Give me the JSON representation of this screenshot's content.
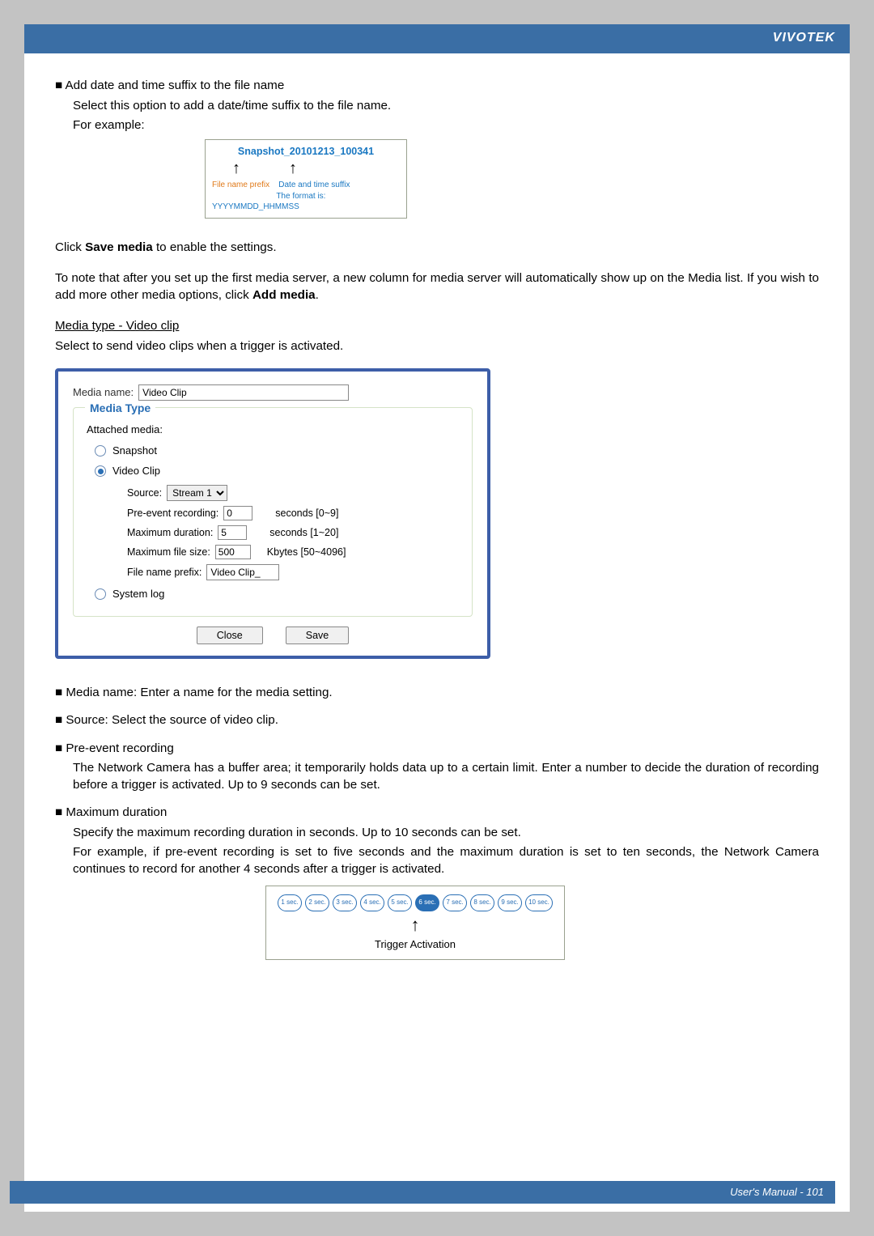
{
  "brand": "VIVOTEK",
  "sec1": {
    "bullet": "■ Add date and time suffix to the file name",
    "line1": "Select this option to add a date/time suffix to the file name.",
    "line2": "For example:"
  },
  "snapshot": {
    "title": "Snapshot_20101213_100341",
    "arrow1": "↑",
    "arrow2": "↑",
    "label1": "File name prefix",
    "label2a": "Date and time suffix",
    "label2b": "The format is: YYYYMMDD_HHMMSS"
  },
  "save_line_pre": "Click ",
  "save_line_bold": "Save media",
  "save_line_post": " to enable the settings.",
  "note_pre": "To note that after you set up the first media server, a new column for media server will automatically show up on the Media list.  If you wish to add more other media options, click ",
  "note_bold": "Add media",
  "note_post": ".",
  "mtype_head": "Media type - Video clip",
  "mtype_desc": "Select to send video clips when a trigger is activated.",
  "dialog": {
    "media_name_label": "Media name:",
    "media_name_value": "Video Clip",
    "legend": "Media Type",
    "attached_label": "Attached media:",
    "radio_snapshot": "Snapshot",
    "radio_videoclip": "Video Clip",
    "radio_systemlog": "System log",
    "source_label": "Source:",
    "source_value": "Stream 1",
    "pre_label": "Pre-event recording:",
    "pre_value": "0",
    "pre_hint": "seconds [0~9]",
    "maxdur_label": "Maximum duration:",
    "maxdur_value": "5",
    "maxdur_hint": "seconds [1~20]",
    "maxsize_label": "Maximum file size:",
    "maxsize_value": "500",
    "maxsize_hint": "Kbytes [50~4096]",
    "prefix_label": "File name prefix:",
    "prefix_value": "Video Clip_",
    "btn_close": "Close",
    "btn_save": "Save"
  },
  "bullets2": {
    "b1": "■ Media name: Enter a name for the media setting.",
    "b2": "■ Source: Select the source of video clip.",
    "b3_head": "■ Pre-event recording",
    "b3_body": "The Network Camera has a buffer area; it temporarily holds data up to a certain limit. Enter a number to decide the duration of recording before a trigger is activated. Up to 9 seconds can be set.",
    "b4_head": "■ Maximum duration",
    "b4_l1": "Specify the maximum recording duration in seconds. Up to 10 seconds can be set.",
    "b4_l2": "For example, if pre-event recording is set to five seconds and the maximum duration is set to ten seconds, the Network Camera continues to record for another 4 seconds after a trigger is activated."
  },
  "trigger": {
    "dots": [
      "1 sec.",
      "2 sec.",
      "3 sec.",
      "4 sec.",
      "5 sec.",
      "6 sec.",
      "7 sec.",
      "8 sec.",
      "9 sec.",
      "10 sec."
    ],
    "filled_index": 5,
    "arrow": "↑",
    "label": "Trigger Activation"
  },
  "footer": "User's Manual - 101"
}
